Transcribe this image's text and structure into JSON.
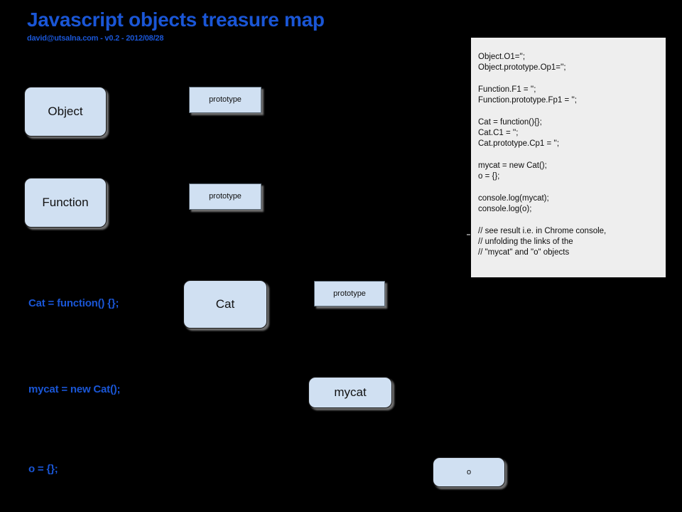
{
  "header": {
    "title": "Javascript objects treasure map",
    "subtitle": "david@utsalna.com - v0.2 - 2012/08/28",
    "accent_color": "#1a56d6"
  },
  "canvas": {
    "background_color": "#000000",
    "node_fill_color": "#d0e0f2",
    "node_border_color": "#1d1d1d",
    "code_panel_color": "#eeeeee"
  },
  "nodes": [
    {
      "id": "object",
      "label": "Object",
      "shape": "rounded"
    },
    {
      "id": "object-proto",
      "label": "prototype",
      "shape": "rect"
    },
    {
      "id": "function",
      "label": "Function",
      "shape": "rounded"
    },
    {
      "id": "function-proto",
      "label": "prototype",
      "shape": "rect"
    },
    {
      "id": "cat",
      "label": "Cat",
      "shape": "rounded"
    },
    {
      "id": "cat-proto",
      "label": "prototype",
      "shape": "rect"
    },
    {
      "id": "mycat",
      "label": "mycat",
      "shape": "rounded"
    },
    {
      "id": "o",
      "label": "o",
      "shape": "rounded"
    }
  ],
  "annotations": [
    {
      "id": "cat-annot",
      "text": "Cat = function() {};"
    },
    {
      "id": "mycat-annot",
      "text": "mycat = new Cat();"
    },
    {
      "id": "o-annot",
      "text": "o = {};"
    }
  ],
  "code_panel": {
    "lines": [
      "Object.O1='';",
      "Object.prototype.Op1='';",
      "",
      "Function.F1 = '';",
      "Function.prototype.Fp1 = '';",
      "",
      "Cat = function(){};",
      "Cat.C1 = '';",
      "Cat.prototype.Cp1 = '';",
      "",
      "mycat = new Cat();",
      "o = {};",
      "",
      "console.log(mycat);",
      "console.log(o);",
      "",
      "// see result i.e. in Chrome console,",
      "// unfolding the links of the",
      "// \"mycat\" and \"o\" objects"
    ]
  }
}
